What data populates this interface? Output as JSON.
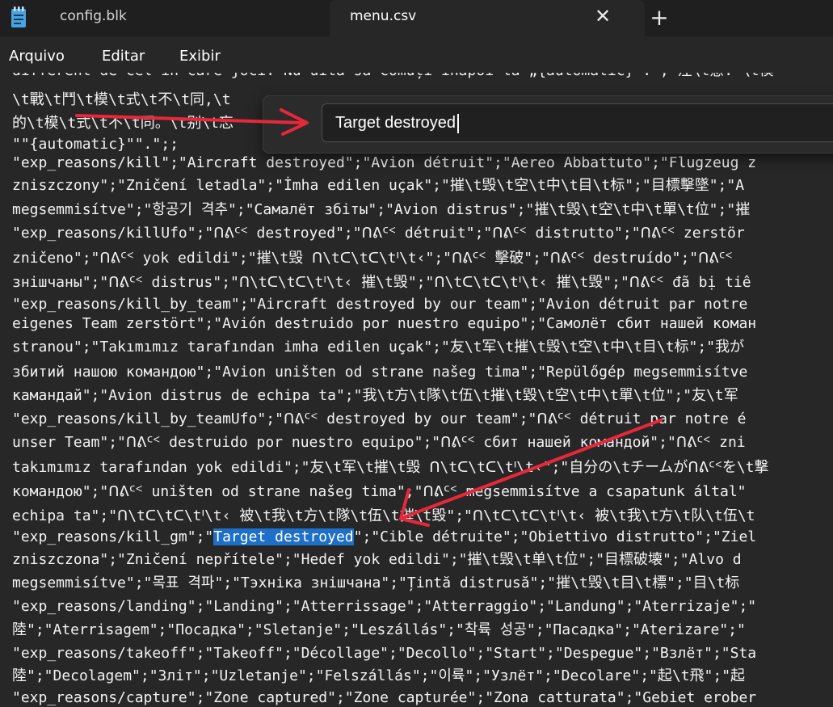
{
  "tabs": [
    {
      "label": "config.blk",
      "active": false,
      "icon": "notepad-icon"
    },
    {
      "label": "menu.csv",
      "active": true
    }
  ],
  "tab_close_glyph": "✕",
  "new_tab_glyph": "+",
  "menu": [
    "Arquivo",
    "Editar",
    "Exibir"
  ],
  "find": {
    "value": "Target destroyed"
  },
  "lines": [
    "different de cel in care joci. Nu uita sa comuți înapoi la „{automatic}\". ; 注\\t意: \\t模",
    "\\t戰\\t鬥\\t模\\t式\\t不\\t同,\\t",
    "的\\t模\\t式\\t不\\t同。\\t别\\t忘",
    "\"\"{automatic}\"\".\";;",
    "\"exp_reasons/kill\";\"Aircraft destroyed\";\"Avion détruit\";\"Aereo Abbattuto\";\"Flugzeug z",
    "zniszczony\";\"Zničení letadla\";\"İmha edilen uçak\";\"摧\\t毁\\t空\\t中\\t目\\t标\";\"目標擊墜\";\"А",
    "megsemmisítve\";\"항공기 격추\";\"Самалёт збіты\";\"Avion distrus\";\"摧\\t毁\\t空\\t中\\t單\\t位\";\"摧",
    "\"exp_reasons/killUfo\";\"ᑎᕕᑦᑉ destroyed\";\"ᑎᕕᑦᑉ détruit\";\"ᑎᕕᑦᑉ distrutto\";\"ᑎᕕᑦᑉ zerstör",
    "zničeno\";\"ᑎᕕᑦᑉ yok edildi\";\"摧\\t毁 ᑎ\\tᑕ\\tᑕ\\tᑊ\\t‹\";\"ᑎᕕᑦᑉ 擊破\";\"ᑎᕕᑦᑉ destruído\";\"ᑎᕕᑦᑉ",
    "знішчаны\";\"ᑎᕕᑦᑉ distrus\";\"ᑎ\\tᑕ\\tᑕ\\tᑊ\\t‹ 摧\\t毁\";\"ᑎ\\tᑕ\\tᑕ\\tᑊ\\t‹ 摧\\t毁\";\"ᑎᕕᑦᑉ đã bị tiê",
    "\"exp_reasons/kill_by_team\";\"Aircraft destroyed by our team\";\"Avion détruit par notre",
    "eigenes Team zerstört\";\"Avión destruido por nuestro equipo\";\"Самолёт сбит нашей коман",
    "stranou\";\"Takımımız tarafından imha edilen uçak\";\"友\\t军\\t摧\\t毁\\t空\\t中\\t目\\t标\";\"我が",
    "збитий нашою командою\";\"Avion uništen od strane našeg tima\";\"Repülőgép megsemmisítve",
    "камандай\";\"Avion distrus de echipa ta\";\"我\\t方\\t隊\\t伍\\t摧\\t毀\\t空\\t中\\t單\\t位\";\"友\\t军",
    "\"exp_reasons/kill_by_teamUfo\";\"ᑎᕕᑦᑉ destroyed by our team\";\"ᑎᕕᑦᑉ détruit par notre é",
    "unser Team\";\"ᑎᕕᑦᑉ destruido por nuestro equipo\";\"ᑎᕕᑦᑉ сбит нашей командой\";\"ᑎᕕᑦᑉ zni",
    "takımımız tarafından yok edildi\";\"友\\t军\\t摧\\t毁 ᑎ\\tᑕ\\tᑕ\\tᑊ\\t‹\";\"自分の\\tチームがᑎᕕᑦᑉを\\t撃",
    "командою\";\"ᑎᕕᑦᑉ uništen od strane našeg tima\";\"ᑎᕕᑦᑉ megsemmisítve a csapatunk által\"",
    "echipa ta\";\"ᑎ\\tᑕ\\tᑕ\\tᑊ\\t‹ 被\\t我\\t方\\t隊\\t伍\\t摧\\t毀\";\"ᑎ\\tᑕ\\tᑕ\\tᑊ\\t‹ 被\\t我\\t方\\t队\\t伍\\t",
    {
      "pre": "\"exp_reasons/kill_gm\";\"",
      "hl": "Target destroyed",
      "post": "\";\"Cible détruite\";\"Obiettivo distrutto\";\"Ziel"
    },
    "zniszczona\";\"Zničení nepřítele\";\"Hedef yok edildi\";\"摧\\t毁\\t单\\t位\";\"目標破壊\";\"Alvo d",
    "megsemmisítve\";\"목표 격파\";\"Тэхніка знішчана\";\"Țintă distrusă\";\"摧\\t毁\\t目\\t標\";\"目\\t标",
    "\"exp_reasons/landing\";\"Landing\";\"Atterrissage\";\"Atterraggio\";\"Landung\";\"Aterrizaje\";\"",
    "陸\";\"Aterrisagem\";\"Посадка\";\"Sletanje\";\"Leszállás\";\"착륙 성공\";\"Пасадка\";\"Aterizare\";\"",
    "\"exp_reasons/takeoff\";\"Takeoff\";\"Décollage\";\"Decollo\";\"Start\";\"Despegue\";\"Взлёт\";\"Sta",
    "陸\";\"Decolagem\";\"Зліт\";\"Uzletanje\";\"Felszállás\";\"이륙\";\"Узлёт\";\"Decolare\";\"起\\t飛\";\"起",
    "\"exp_reasons/capture\";\"Zone captured\";\"Zone capturée\";\"Zona catturata\";\"Gebiet erober"
  ],
  "colors": {
    "highlight": "#1e6fc8",
    "arrow": "#e8283a",
    "background": "#272727",
    "tabbar": "#1f1f1f"
  }
}
